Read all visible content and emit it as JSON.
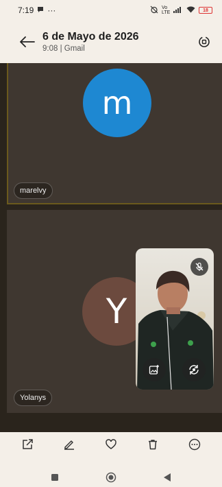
{
  "status_bar": {
    "time": "7:19",
    "more_indicator": "···",
    "network_label": "Vo LTE",
    "battery_level": "18"
  },
  "header": {
    "title": "6 de Mayo de 2026",
    "subtitle": "9:08 | Gmail"
  },
  "call": {
    "participants": [
      {
        "name": "marelvy",
        "initial": "m",
        "avatar_color": "#1e88d2"
      },
      {
        "name": "Yolanys",
        "initial": "Y",
        "avatar_color": "#6c4a3e"
      }
    ],
    "self_view": {
      "mic_muted": true
    }
  },
  "toolbar": {
    "icons": [
      "share-icon",
      "edit-icon",
      "favorite-icon",
      "delete-icon",
      "more-icon"
    ]
  },
  "navigation": {
    "icons": [
      "recents-icon",
      "home-icon",
      "back-icon"
    ]
  },
  "colors": {
    "background": "#f4efe8",
    "tile": "#3f3730",
    "accent_border": "#6b5a1d"
  }
}
